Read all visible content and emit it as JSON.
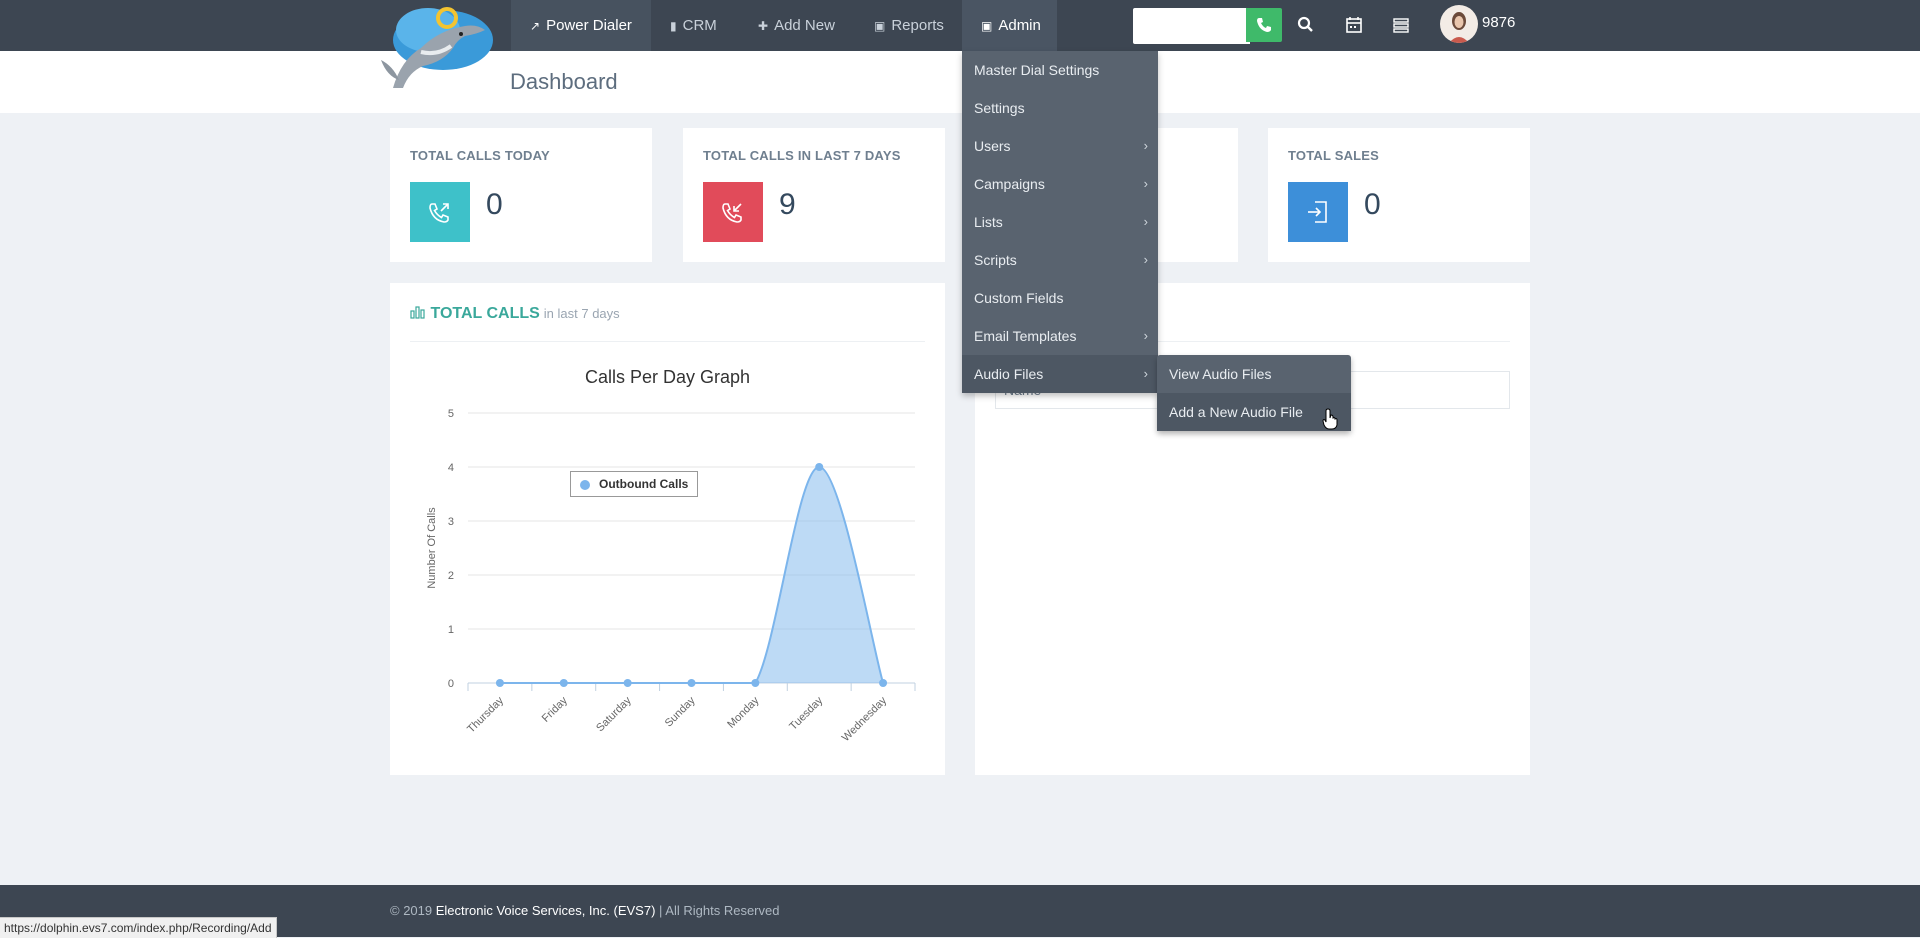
{
  "colors": {
    "topbar": "#3d4652",
    "teal": "#3ec1c9",
    "red": "#e14b5a",
    "blue": "#3d8fd9",
    "accent_green": "#3fba6a",
    "series": "#7cb5ec"
  },
  "nav": {
    "items": [
      {
        "icon": "link-icon",
        "label": "Power Dialer"
      },
      {
        "icon": "book-icon",
        "label": "CRM"
      },
      {
        "icon": "plus-icon",
        "label": "Add New"
      },
      {
        "icon": "lock-icon",
        "label": "Reports"
      },
      {
        "icon": "lock-icon",
        "label": "Admin"
      }
    ],
    "search_placeholder": "",
    "username": "9876"
  },
  "page": {
    "title": "Dashboard"
  },
  "stats": [
    {
      "title": "TOTAL CALLS TODAY",
      "value": "0",
      "icon": "phone-outgoing-icon"
    },
    {
      "title": "TOTAL CALLS IN LAST 7 DAYS",
      "value": "9",
      "icon": "phone-incoming-icon"
    },
    {
      "title": "TOTAL SALES",
      "value": "0",
      "icon": "sign-in-icon"
    }
  ],
  "calls_panel": {
    "title": "TOTAL CALLS",
    "subtitle": "in last 7 days"
  },
  "table_panel": {
    "header": "Name"
  },
  "chart_data": {
    "type": "area",
    "title": "Calls Per Day Graph",
    "xlabel": "",
    "ylabel": "Number Of Calls",
    "categories": [
      "Thursday",
      "Friday",
      "Saturday",
      "Sunday",
      "Monday",
      "Tuesday",
      "Wednesday"
    ],
    "series": [
      {
        "name": "Outbound Calls",
        "values": [
          0,
          0,
          0,
          0,
          0,
          4,
          0
        ]
      }
    ],
    "yticks": [
      0,
      1,
      2,
      3,
      4,
      5
    ],
    "ylim": [
      0,
      5
    ],
    "grid": true,
    "legend": "top-left"
  },
  "admin_menu": {
    "items": [
      {
        "label": "Master Dial Settings",
        "submenu": false
      },
      {
        "label": "Settings",
        "submenu": false
      },
      {
        "label": "Users",
        "submenu": true
      },
      {
        "label": "Campaigns",
        "submenu": true
      },
      {
        "label": "Lists",
        "submenu": true
      },
      {
        "label": "Scripts",
        "submenu": true
      },
      {
        "label": "Custom Fields",
        "submenu": false
      },
      {
        "label": "Email Templates",
        "submenu": true
      },
      {
        "label": "Audio Files",
        "submenu": true
      }
    ],
    "audio_submenu": [
      "View Audio Files",
      "Add a New Audio File"
    ]
  },
  "footer": {
    "prefix": "© 2019",
    "company": "Electronic Voice Services, Inc. (EVS7)",
    "suffix": "| All Rights Reserved"
  },
  "status_url": "https://dolphin.evs7.com/index.php/Recording/Add"
}
